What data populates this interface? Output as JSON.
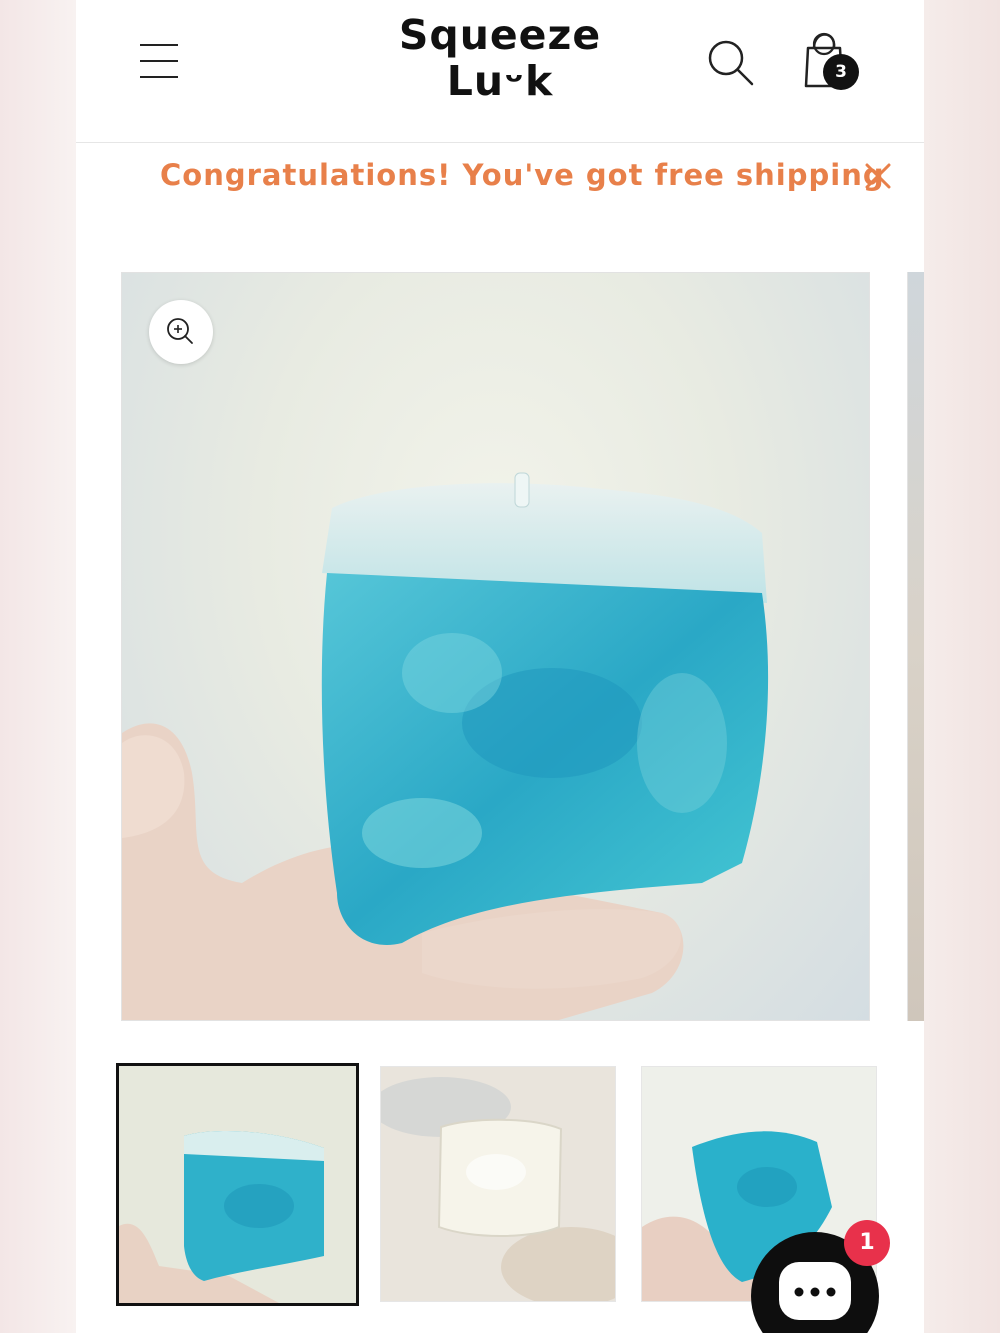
{
  "header": {
    "menu_icon": "hamburger-menu-icon",
    "logo_line1": "Squeeze",
    "logo_line2": "Luᵕk",
    "search_icon": "search-icon",
    "cart_icon": "shopping-bag-icon",
    "cart_count": "3"
  },
  "announcement": {
    "text": "Congratulations! You've got free shipping",
    "color": "#e8804a",
    "close_icon": "close-icon"
  },
  "gallery": {
    "zoom_icon": "zoom-in-icon",
    "main_image": "blue-jelly-cube-held-in-hand",
    "thumbnails": [
      {
        "image": "blue-jelly-cube-held-in-hand",
        "selected": true
      },
      {
        "image": "clear-jelly-cube-on-fur",
        "selected": false
      },
      {
        "image": "blue-jelly-cube-on-palm",
        "selected": false
      }
    ]
  },
  "chat": {
    "icon": "chat-bubble-icon",
    "badge_count": "1",
    "badge_color": "#e8314b"
  }
}
